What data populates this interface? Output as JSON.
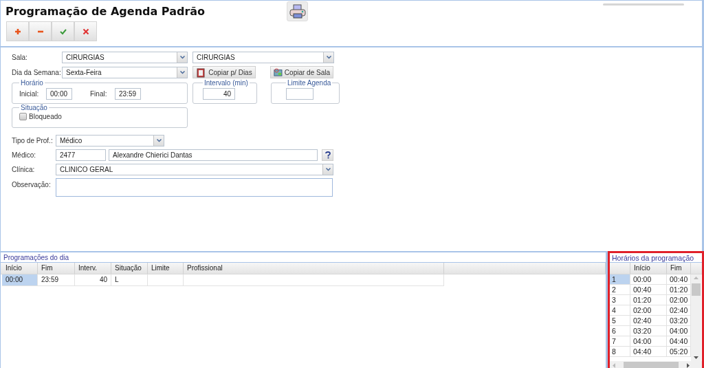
{
  "title": "Programação de Agenda Padrão",
  "toolbar": [
    {
      "kind": "add"
    },
    {
      "kind": "remove"
    },
    {
      "kind": "confirm"
    },
    {
      "kind": "cancel"
    }
  ],
  "form": {
    "sala_label": "Sala:",
    "sala": "CIRURGIAS",
    "sala_2": "CIRURGIAS",
    "day_label": "Dia da Semana:",
    "day": "Sexta-Feira",
    "copy_buttons": [
      {
        "kind": "days",
        "label": "Copiar p/ Dias"
      },
      {
        "kind": "room",
        "label": "Copiar de Sala"
      }
    ],
    "schedule": {
      "title": "Horário",
      "start_label": "Inicial:",
      "start": "00:00",
      "end_label": "Final:",
      "end": "23:59"
    },
    "interval": {
      "title": "Intervalo (min)",
      "value": "40"
    },
    "limit": {
      "title": "Limite Agenda"
    },
    "status": {
      "title": "Situação",
      "label": "Bloqueado",
      "checked": false
    },
    "prof_type_label": "Tipo de Prof.:",
    "prof_type": "Médico",
    "doctor_label": "Médico:",
    "doctor_code": "2477",
    "doctor_name": "Alexandre Chierici Dantas",
    "clinic_label": "Clínica:",
    "clinic": "CLINICO GERAL",
    "note_label": "Observação:"
  },
  "day_grid": {
    "title": "Programações do dia",
    "columns": [
      "Início",
      "Fim",
      "Interv.",
      "Situação",
      "Limite",
      "Profissional"
    ],
    "rows": [
      {
        "start": "00:00",
        "end": "23:59",
        "interval": "40",
        "status": "L",
        "selected": true
      }
    ]
  },
  "slot_grid": {
    "title": "Horários da programação",
    "columns": [
      "Início",
      "Fim"
    ],
    "rows": [
      {
        "number": "1",
        "start": "00:00",
        "end": "00:40",
        "selected": true
      },
      {
        "number": "2",
        "start": "00:40",
        "end": "01:20",
        "selected": false
      },
      {
        "number": "3",
        "start": "01:20",
        "end": "02:00",
        "selected": false
      },
      {
        "number": "4",
        "start": "02:00",
        "end": "02:40",
        "selected": false
      },
      {
        "number": "5",
        "start": "02:40",
        "end": "03:20",
        "selected": false
      },
      {
        "number": "6",
        "start": "03:20",
        "end": "04:00",
        "selected": false
      },
      {
        "number": "7",
        "start": "04:00",
        "end": "04:40",
        "selected": false
      },
      {
        "number": "8",
        "start": "04:40",
        "end": "05:20",
        "selected": false
      }
    ]
  }
}
